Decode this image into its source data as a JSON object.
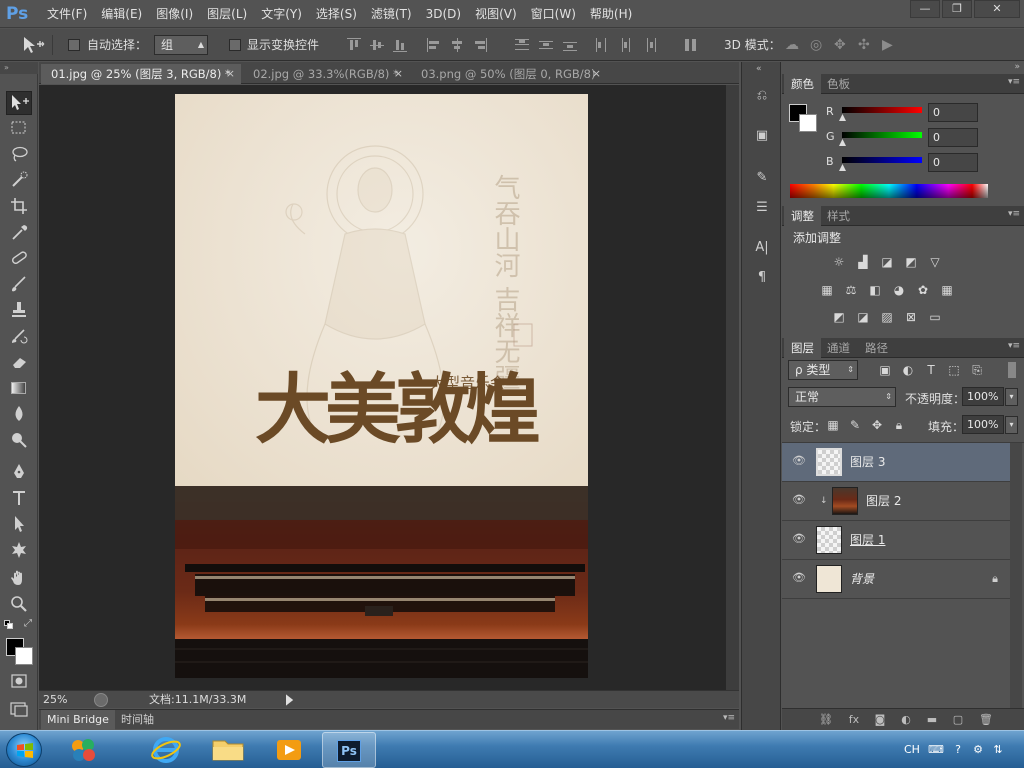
{
  "app": {
    "logo": "Ps"
  },
  "menu": [
    "文件(F)",
    "编辑(E)",
    "图像(I)",
    "图层(L)",
    "文字(Y)",
    "选择(S)",
    "滤镜(T)",
    "3D(D)",
    "视图(V)",
    "窗口(W)",
    "帮助(H)"
  ],
  "window_buttons": {
    "minimize": "—",
    "restore": "❐",
    "close": "✕"
  },
  "options": {
    "auto_select_label": "自动选择：",
    "auto_select_value": "组",
    "show_transform_label": "显示变换控件",
    "mode_3d_label": "3D 模式："
  },
  "tabs": [
    {
      "label": "01.jpg @ 25% (图层 3, RGB/8) *",
      "close": "×"
    },
    {
      "label": "02.jpg @ 33.3%(RGB/8) *",
      "close": "×"
    },
    {
      "label": "03.png @ 50% (图层 0, RGB/8)",
      "close": "×"
    }
  ],
  "poster": {
    "title": "大美敦煌",
    "subtitle": "大型音乐会",
    "calligraphy": "气吞山河 吉祥无疆"
  },
  "status": {
    "zoom": "25%",
    "doc": "文档:11.1M/33.3M"
  },
  "bottom_tabs": [
    "Mini Bridge",
    "时间轴"
  ],
  "color_panel": {
    "tabs": [
      "颜色",
      "色板"
    ],
    "r_label": "R",
    "g_label": "G",
    "b_label": "B",
    "r_value": "0",
    "g_value": "0",
    "b_value": "0",
    "foreground": "#000000",
    "background": "#ffffff"
  },
  "adjust_panel": {
    "tabs": [
      "调整",
      "样式"
    ],
    "heading": "添加调整"
  },
  "layers_panel": {
    "tabs": [
      "图层",
      "通道",
      "路径"
    ],
    "filter_label": "ρ 类型",
    "blend_mode": "正常",
    "opacity_label": "不透明度：",
    "opacity_value": "100%",
    "lock_label": "锁定：",
    "fill_label": "填充：",
    "fill_value": "100%",
    "layers": [
      {
        "name": "图层 3",
        "selected": true
      },
      {
        "name": "图层 2",
        "selected": false
      },
      {
        "name": "图层 1",
        "selected": false
      },
      {
        "name": "背景",
        "selected": false
      }
    ]
  },
  "taskbar": {
    "lang": "CH",
    "ps_label": "Ps"
  }
}
